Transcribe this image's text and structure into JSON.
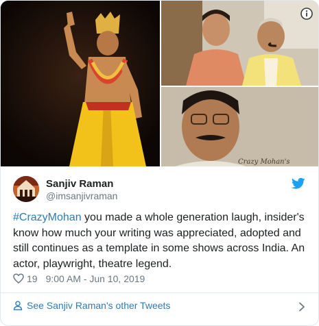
{
  "tweet": {
    "author_name": "Sanjiv Raman",
    "author_handle": "@imsanjivraman",
    "hashtag": "#CrazyMohan",
    "body": " you made a whole generation laugh, insider's know how much your writing was appreciated, adopted and still continues as a template in some shows across India. An actor, playwright, theatre legend.",
    "likes": "19",
    "timestamp": "9:00 AM - Jun 10, 2019",
    "image_caption_text": "Crazy Mohan's"
  },
  "footer": {
    "other_tweets_label": "See Sanjiv Raman's other Tweets"
  },
  "icons": {
    "info": "info-icon",
    "twitter": "twitter-bird-icon",
    "heart": "heart-icon",
    "person": "person-icon",
    "chevron": "chevron-right-icon"
  },
  "colors": {
    "link": "#2b7bb9",
    "twitter_blue": "#1da1f2",
    "muted": "#697882",
    "text": "#1c2022",
    "border": "#e1e8ed"
  }
}
